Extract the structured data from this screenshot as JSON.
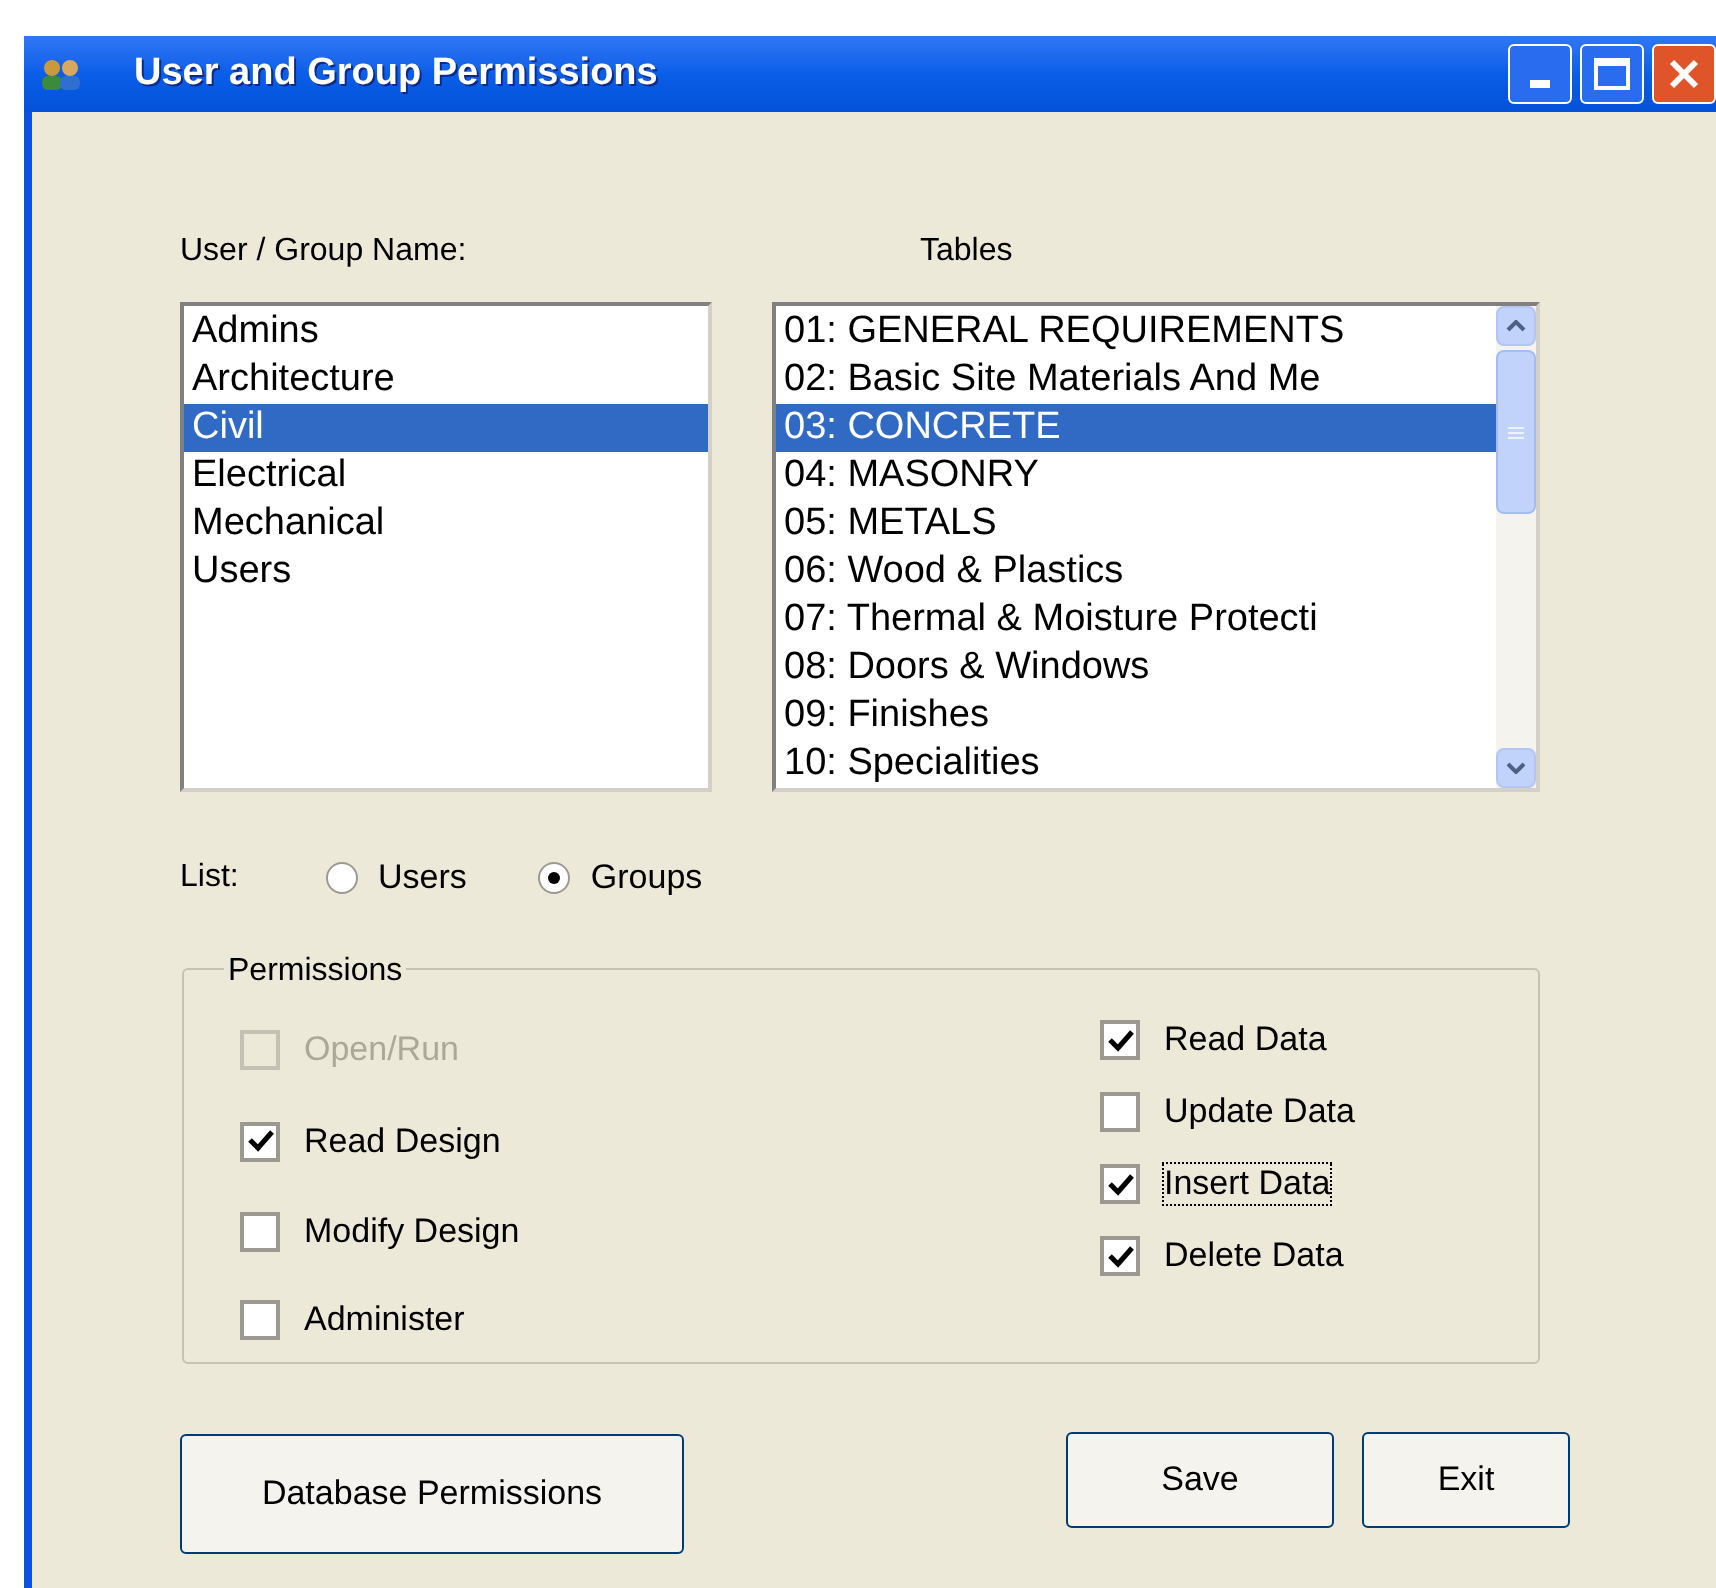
{
  "window": {
    "title": "User and Group Permissions"
  },
  "user_group_label": "User / Group Name:",
  "tables_label": "Tables",
  "user_groups": [
    {
      "label": "Admins",
      "selected": false
    },
    {
      "label": "Architecture",
      "selected": false
    },
    {
      "label": "Civil",
      "selected": true
    },
    {
      "label": "Electrical",
      "selected": false
    },
    {
      "label": "Mechanical",
      "selected": false
    },
    {
      "label": "Users",
      "selected": false
    }
  ],
  "tables": [
    {
      "label": "01: GENERAL REQUIREMENTS",
      "selected": false
    },
    {
      "label": "02: Basic Site Materials And Me",
      "selected": false
    },
    {
      "label": "03: CONCRETE",
      "selected": true
    },
    {
      "label": "04: MASONRY",
      "selected": false
    },
    {
      "label": "05: METALS",
      "selected": false
    },
    {
      "label": "06: Wood & Plastics",
      "selected": false
    },
    {
      "label": "07: Thermal & Moisture Protecti",
      "selected": false
    },
    {
      "label": "08: Doors & Windows",
      "selected": false
    },
    {
      "label": "09: Finishes",
      "selected": false
    },
    {
      "label": "10: Specialities",
      "selected": false
    }
  ],
  "list_label": "List:",
  "list_options": [
    {
      "label": "Users",
      "selected": false
    },
    {
      "label": "Groups",
      "selected": true
    }
  ],
  "permissions": {
    "title": "Permissions",
    "left": [
      {
        "label": "Open/Run",
        "checked": false,
        "disabled": true,
        "focused": false
      },
      {
        "label": "Read Design",
        "checked": true,
        "disabled": false,
        "focused": false
      },
      {
        "label": "Modify Design",
        "checked": false,
        "disabled": false,
        "focused": false
      },
      {
        "label": "Administer",
        "checked": false,
        "disabled": false,
        "focused": false
      }
    ],
    "right": [
      {
        "label": "Read Data",
        "checked": true,
        "disabled": false,
        "focused": false
      },
      {
        "label": "Update Data",
        "checked": false,
        "disabled": false,
        "focused": false
      },
      {
        "label": "Insert Data",
        "checked": true,
        "disabled": false,
        "focused": true
      },
      {
        "label": "Delete Data",
        "checked": true,
        "disabled": false,
        "focused": false
      }
    ]
  },
  "buttons": {
    "database_permissions": "Database Permissions",
    "save": "Save",
    "exit": "Exit"
  }
}
